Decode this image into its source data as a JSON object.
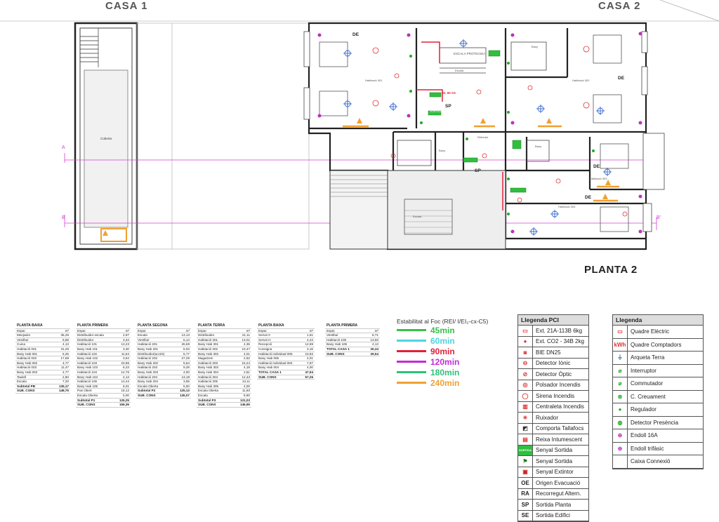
{
  "titles": {
    "casa1": "CASA 1",
    "casa2": "CASA 2",
    "planta": "PLANTA 2"
  },
  "plan_labels": {
    "de1": "DE",
    "de2": "DE",
    "de3": "DE",
    "de4": "DE",
    "sp1": "SP",
    "sp2": "SP",
    "escala_protegida": "ESCALA PROTEGIDA",
    "escala": "Escala",
    "hab301": "Habitació 301",
    "hab302": "Habitació 302",
    "hab303": "Habitació 303",
    "hab304": "Habitació 304",
    "bany": "Bany",
    "rebedor": "Rebedor",
    "coberta": "Coberta",
    "sortida": "SORTIDA",
    "ei": "EI, 60 C5",
    "section_a": "A",
    "section_a2": "A'",
    "section_b": "B",
    "section_b2": "B'"
  },
  "tables": [
    {
      "title": "PLANTA BAIXA",
      "head": [
        "Espai",
        "m²"
      ],
      "rows": [
        [
          "Menjador",
          "35,26"
        ],
        [
          "Vestíbul",
          "6,58"
        ],
        [
          "Cuina",
          "4,13"
        ],
        [
          "Habitació 001",
          "31,26"
        ],
        [
          "Bany Hab 001",
          "5,25"
        ],
        [
          "Habitació 002",
          "17,88"
        ],
        [
          "Bany Hab 002",
          "4,77"
        ],
        [
          "Habitació 003",
          "11,47"
        ],
        [
          "Bany Hab 003",
          "4,77"
        ],
        [
          "Taulell",
          "2,60"
        ],
        [
          "Escala",
          "7,20"
        ]
      ],
      "totals": [
        [
          "Subtotal PB",
          "135,17"
        ],
        [
          "SUB. CONS",
          "148,75"
        ]
      ]
    },
    {
      "title": "PLANTA PRIMERA",
      "head": [
        "Espai",
        "m²"
      ],
      "rows": [
        [
          "Distribuidor escala",
          "2,67"
        ],
        [
          "Distribuidor",
          "3,34"
        ],
        [
          "Habitació 101",
          "13,23"
        ],
        [
          "Bany Hab 101",
          "3,30"
        ],
        [
          "Habitació 102",
          "11,64"
        ],
        [
          "Bany Hab 102",
          "3,54"
        ],
        [
          "Habitació 103",
          "23,85"
        ],
        [
          "Bany Hab 103",
          "6,23"
        ],
        [
          "Habitació 104",
          "12,76"
        ],
        [
          "Bany Hab 104",
          "4,13"
        ],
        [
          "Habitació 105",
          "13,44"
        ],
        [
          "Bany Hab 105",
          "6,01"
        ],
        [
          "Pas Obert",
          "18,12"
        ],
        [
          "Escala Oberta",
          "5,00"
        ]
      ],
      "totals": [
        [
          "Subtotal P1",
          "125,25"
        ],
        [
          "SUB. CONS",
          "155,35"
        ]
      ]
    },
    {
      "title": "PLANTA SEGONA",
      "head": [
        "Espai",
        "m²"
      ],
      "rows": [
        [
          "Escala",
          "13,13"
        ],
        [
          "Vestíbul",
          "6,14"
        ],
        [
          "Habitació 201",
          "26,69"
        ],
        [
          "Bany Hab 201",
          "5,03"
        ],
        [
          "Distribuidor(accés)",
          "5,77"
        ],
        [
          "Habitació 202",
          "27,29"
        ],
        [
          "Bany Hab 202",
          "5,54"
        ],
        [
          "Habitació 203",
          "9,29"
        ],
        [
          "Bany Hab 203",
          "4,00"
        ],
        [
          "Habitació 204",
          "13,18"
        ],
        [
          "Bany Hab 204",
          "3,55"
        ],
        [
          "Escala Oberta",
          "5,00"
        ]
      ],
      "totals": [
        [
          "Subtotal P2",
          "125,13"
        ],
        [
          "SUB. CONS",
          "136,07"
        ]
      ]
    },
    {
      "title": "PLANTA TERRA",
      "head": [
        "Espai",
        "m²"
      ],
      "rows": [
        [
          "Distribuidor",
          "21,11"
        ],
        [
          "Habitació 301",
          "13,01"
        ],
        [
          "Bany Hab 301",
          "4,35"
        ],
        [
          "Habitació 302",
          "10,47"
        ],
        [
          "Bany Hab 302",
          "4,01"
        ],
        [
          "Magatzem",
          "2,62"
        ],
        [
          "Habitació 303",
          "15,24"
        ],
        [
          "Bany Hab 303",
          "4,18"
        ],
        [
          "Bany Hab 304",
          "2,81"
        ],
        [
          "Habitació 304",
          "12,43"
        ],
        [
          "Habitació 305",
          "13,11"
        ],
        [
          "Bany Hab 305",
          "4,00"
        ],
        [
          "Escala Oberta",
          "11,60"
        ],
        [
          "Escala",
          "8,90"
        ]
      ],
      "totals": [
        [
          "Subtotal P3",
          "131,03"
        ],
        [
          "SUB. CONS",
          "146,95"
        ]
      ]
    },
    {
      "title": "PLANTA BAIXA",
      "head": [
        "Espai",
        "m²"
      ],
      "rows": [
        [
          "Servei 0",
          "1,51"
        ],
        [
          "Servei H",
          "4,44"
        ],
        [
          "Recepció",
          "12,89"
        ],
        [
          "Consigna",
          "3,16"
        ],
        [
          "Habitació individual 005",
          "10,82"
        ],
        [
          "Bany Hab 005",
          "4,01"
        ],
        [
          "Habitació individual 004",
          "7,67"
        ],
        [
          "Bany Hab 004",
          "4,00"
        ]
      ],
      "totals": [
        [
          "TOTAL CASA 1",
          "47,94"
        ],
        [
          "SUB. CONS",
          "57,26"
        ]
      ]
    },
    {
      "title": "PLANTA PRIMERA",
      "head": [
        "Espai",
        "m²"
      ],
      "rows": [
        [
          "Vestíbul",
          "8,71"
        ],
        [
          "Habitació 106",
          "13,50"
        ],
        [
          "Bany Hab 106",
          "4,13"
        ]
      ],
      "totals": [
        [
          "TOTAL CASA 1",
          "26,34"
        ],
        [
          "SUB. CONS",
          "29,54"
        ]
      ]
    }
  ],
  "fire": {
    "title": "Estabilitat al Foc (REI/ I/EI₂-cx-C5)",
    "items": [
      {
        "label": "45min",
        "color": "#39c04a"
      },
      {
        "label": "60min",
        "color": "#4fd4e0"
      },
      {
        "label": "90min",
        "color": "#e0203a"
      },
      {
        "label": "120min",
        "color": "#c22bd8"
      },
      {
        "label": "180min",
        "color": "#2fc07a"
      },
      {
        "label": "240min",
        "color": "#f0a030"
      }
    ]
  },
  "legend_pci": {
    "title": "Llegenda PCI",
    "items": [
      {
        "icon": "ext-21a-icon",
        "label": "Ext. 21A-113B 6kg",
        "glyph": "▭",
        "color": "#d33"
      },
      {
        "icon": "ext-co2-icon",
        "label": "Ext. CO2 - 34B 2kg",
        "glyph": "●",
        "color": "#d33"
      },
      {
        "icon": "bie-icon",
        "label": "BIE DN25",
        "glyph": "◙",
        "color": "#d33"
      },
      {
        "icon": "detector-ionic-icon",
        "label": "Detector Iònic",
        "glyph": "⊖",
        "color": "#d33"
      },
      {
        "icon": "detector-optic-icon",
        "label": "Detector Òptic",
        "glyph": "⊘",
        "color": "#d33"
      },
      {
        "icon": "polsador-icon",
        "label": "Polsador Incendis",
        "glyph": "◎",
        "color": "#d33"
      },
      {
        "icon": "sirena-icon",
        "label": "Sirena Incendis",
        "glyph": "◯",
        "color": "#d33"
      },
      {
        "icon": "centraleta-icon",
        "label": "Centraleta Incendis",
        "glyph": "▥",
        "color": "#d33"
      },
      {
        "icon": "ruixador-icon",
        "label": "Ruixador",
        "glyph": "✳",
        "color": "#d33"
      },
      {
        "icon": "comporta-icon",
        "label": "Comporta Tallafocs",
        "glyph": "◩",
        "color": "#333"
      },
      {
        "icon": "reixa-icon",
        "label": "Reixa Intumescent",
        "glyph": "▤",
        "color": "#d33"
      },
      {
        "icon": "senyal-sortida-icon",
        "label": "Senyal Sortida",
        "glyph": "SORTIDA",
        "color": "#2a2"
      },
      {
        "icon": "senyal-sortida-2-icon",
        "label": "Senyal Sortida",
        "glyph": "⚑",
        "color": "#1a7a1a"
      },
      {
        "icon": "senyal-extintor-icon",
        "label": "Senyal Extintor",
        "glyph": "▣",
        "color": "#c22"
      },
      {
        "icon": "origen-evacuacio-icon",
        "label": "Origen Evacuació",
        "glyph": "OE",
        "color": "#222"
      },
      {
        "icon": "recorregut-alternatiu-icon",
        "label": "Recorregut Altern.",
        "glyph": "RA",
        "color": "#222"
      },
      {
        "icon": "sortida-planta-icon",
        "label": "Sortida Planta",
        "glyph": "SP",
        "color": "#222"
      },
      {
        "icon": "sortida-edifici-icon",
        "label": "Sortida Edifici",
        "glyph": "SE",
        "color": "#222"
      }
    ]
  },
  "legend_elec": {
    "title": "Llegenda",
    "items": [
      {
        "icon": "quadre-electric-icon",
        "label": "Quadre Elèctric",
        "glyph": "▭",
        "color": "#d33"
      },
      {
        "icon": "quadre-comptadors-icon",
        "label": "Quadre Comptadors",
        "glyph": "kWh",
        "color": "#d33"
      },
      {
        "icon": "arqueta-terra-icon",
        "label": "Arqueta Terra",
        "glyph": "⏚",
        "color": "#36a"
      },
      {
        "icon": "interruptor-icon",
        "label": "Interruptor",
        "glyph": "⌀",
        "color": "#2a2"
      },
      {
        "icon": "commutador-icon",
        "label": "Commutador",
        "glyph": "⌀",
        "color": "#2a2"
      },
      {
        "icon": "creuament-icon",
        "label": "C. Creuament",
        "glyph": "⊗",
        "color": "#2a2"
      },
      {
        "icon": "regulador-icon",
        "label": "Regulador",
        "glyph": "●",
        "color": "#2a2"
      },
      {
        "icon": "detector-presencia-icon",
        "label": "Detector Presència",
        "glyph": "◍",
        "color": "#2a2"
      },
      {
        "icon": "endoll-16a-icon",
        "label": "Endoll 16A",
        "glyph": "⊕",
        "color": "#b3b"
      },
      {
        "icon": "endoll-trifasic-icon",
        "label": "Endoll trifàsic",
        "glyph": "⊕",
        "color": "#b3b"
      },
      {
        "icon": "caixa-connexio-icon",
        "label": "Caixa Connexió",
        "glyph": "",
        "color": "#333"
      }
    ]
  }
}
